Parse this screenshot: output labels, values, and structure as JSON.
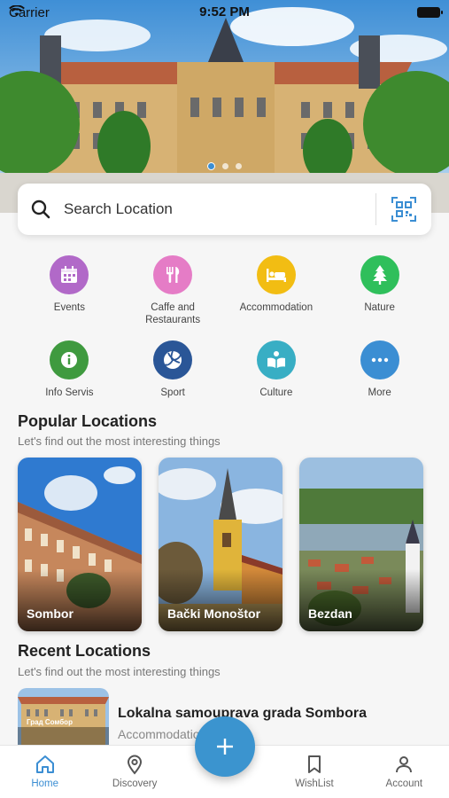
{
  "status_bar": {
    "carrier": "Carrier",
    "time": "9:52 PM"
  },
  "search": {
    "placeholder": "Search Location",
    "value": ""
  },
  "categories": [
    {
      "label": "Events",
      "icon": "calendar-icon",
      "color": "#b169c8"
    },
    {
      "label": "Caffe and Restaurants",
      "icon": "fork-knife-icon",
      "color": "#e57cc6"
    },
    {
      "label": "Accommodation",
      "icon": "bed-icon",
      "color": "#f2bd13"
    },
    {
      "label": "Nature",
      "icon": "tree-icon",
      "color": "#2fbf5b"
    },
    {
      "label": "Info Servis",
      "icon": "info-icon",
      "color": "#3f9a3f"
    },
    {
      "label": "Sport",
      "icon": "volleyball-icon",
      "color": "#2a5697"
    },
    {
      "label": "Culture",
      "icon": "book-reader-icon",
      "color": "#38aec4"
    },
    {
      "label": "More",
      "icon": "more-icon",
      "color": "#3b8ed3"
    }
  ],
  "popular": {
    "title": "Popular Locations",
    "subtitle": "Let's find out the most interesting things",
    "items": [
      {
        "label": "Sombor"
      },
      {
        "label": "Bački Monoštor"
      },
      {
        "label": "Bezdan"
      }
    ]
  },
  "recent": {
    "title": "Recent Locations",
    "subtitle": "Let's find out the most interesting things",
    "items": [
      {
        "title": "Lokalna samouprava grada Sombora",
        "category": "Accommodation",
        "thumb_text": "Град Сомбор"
      }
    ]
  },
  "bottom_nav": {
    "items": [
      {
        "label": "Home",
        "icon": "home-icon",
        "active": true
      },
      {
        "label": "Discovery",
        "icon": "location-pin-icon",
        "active": false
      },
      {
        "label": "WishList",
        "icon": "bookmark-icon",
        "active": false
      },
      {
        "label": "Account",
        "icon": "user-icon",
        "active": false
      }
    ]
  },
  "colors": {
    "accent": "#3b8ed3",
    "fab": "#3b94cf"
  }
}
